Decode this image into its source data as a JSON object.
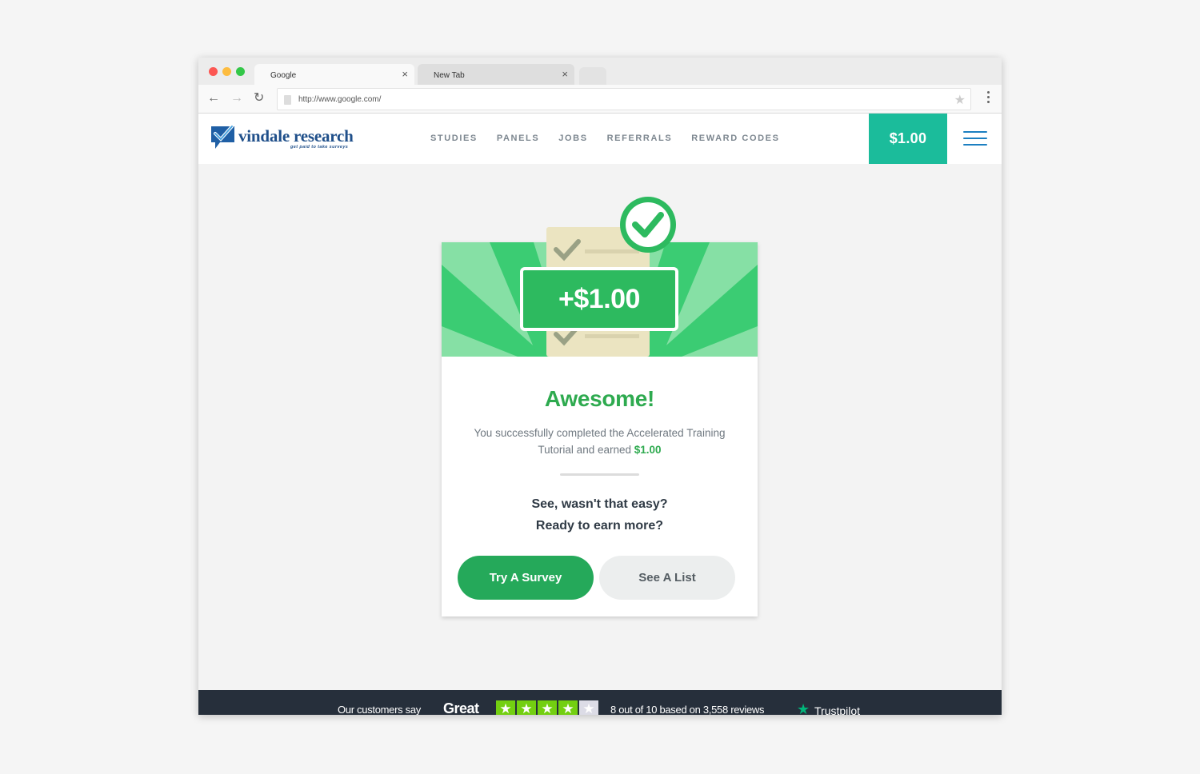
{
  "browser": {
    "tabs": [
      {
        "label": "Google",
        "active": true
      },
      {
        "label": "New Tab",
        "active": false
      }
    ],
    "close_glyph": "×",
    "url": "http://www.google.com/"
  },
  "site": {
    "logo_text": "vindale research",
    "logo_tagline": "get paid to take surveys",
    "nav": [
      "STUDIES",
      "PANELS",
      "JOBS",
      "REFERRALS",
      "REWARD CODES"
    ],
    "balance": "$1.00",
    "brand_color": "#1bbc9b"
  },
  "card": {
    "amount": "+$1.00",
    "headline": "Awesome!",
    "message_prefix": "You successfully completed the Accelerated Training Tutorial and earned",
    "message_amount": "$1.00",
    "prompt_line1": "See, wasn't that easy?",
    "prompt_line2": "Ready to earn more?",
    "primary_button": "Try A Survey",
    "secondary_button": "See A List",
    "accent_color": "#2dba5f"
  },
  "footer": {
    "customers_say": "Our customers say",
    "rating_word": "Great",
    "stars_filled": 4,
    "stars_total": 5,
    "score_text": "8 out of 10 based on 3,558 reviews",
    "trustpilot": "Trustpilot"
  }
}
